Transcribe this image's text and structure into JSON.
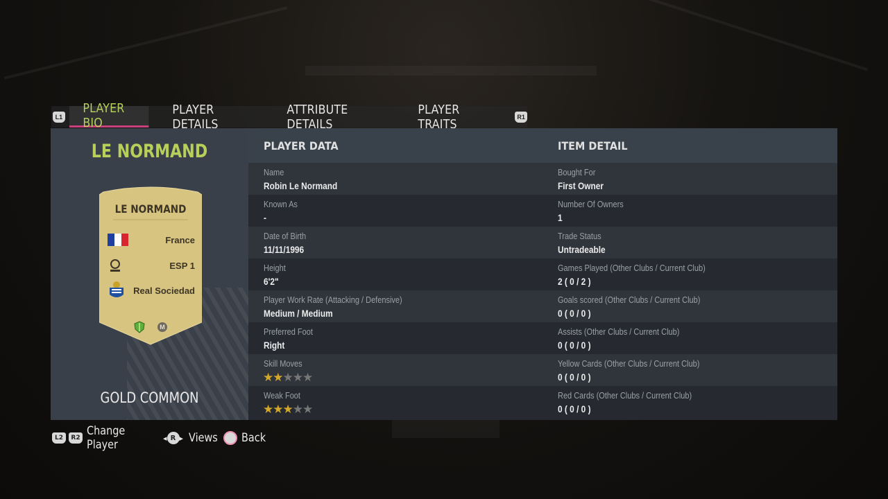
{
  "tabs": {
    "left_shoulder": "L1",
    "right_shoulder": "R1",
    "items": [
      {
        "label": "PLAYER BIO",
        "active": true
      },
      {
        "label": "PLAYER DETAILS",
        "active": false
      },
      {
        "label": "ATTRIBUTE DETAILS",
        "active": false
      },
      {
        "label": "PLAYER TRAITS",
        "active": false
      }
    ]
  },
  "player": {
    "title": "LE NORMAND",
    "card_name": "LE NORMAND",
    "nation": "France",
    "league": "ESP 1",
    "club": "Real Sociedad",
    "chemistry_badge": "M",
    "rarity": "GOLD COMMON"
  },
  "headers": {
    "player_data": "PLAYER DATA",
    "item_detail": "ITEM DETAIL"
  },
  "rows": [
    {
      "left_label": "Name",
      "left_value": "Robin Le Normand",
      "right_label": "Bought For",
      "right_value": "First Owner"
    },
    {
      "left_label": "Known As",
      "left_value": "-",
      "right_label": "Number Of Owners",
      "right_value": "1"
    },
    {
      "left_label": "Date of Birth",
      "left_value": "11/11/1996",
      "right_label": "Trade Status",
      "right_value": "Untradeable"
    },
    {
      "left_label": "Height",
      "left_value": "6'2\"",
      "right_label": "Games Played (Other Clubs / Current Club)",
      "right_value": "2 ( 0 / 2 )"
    },
    {
      "left_label": "Player Work Rate (Attacking / Defensive)",
      "left_value": "Medium / Medium",
      "right_label": "Goals scored (Other Clubs / Current Club)",
      "right_value": "0 ( 0 / 0 )"
    },
    {
      "left_label": "Preferred Foot",
      "left_value": "Right",
      "right_label": "Assists (Other Clubs / Current Club)",
      "right_value": "0 ( 0 / 0 )"
    },
    {
      "left_label": "Skill Moves",
      "left_stars": 2,
      "right_label": "Yellow Cards (Other Clubs / Current Club)",
      "right_value": "0 ( 0 / 0 )"
    },
    {
      "left_label": "Weak Foot",
      "left_stars": 3,
      "right_label": "Red Cards (Other Clubs / Current Club)",
      "right_value": "0 ( 0 / 0 )"
    }
  ],
  "footer": {
    "l2": "L2",
    "r2": "R2",
    "change_player": "Change Player",
    "r_stick": "R",
    "views": "Views",
    "back": "Back"
  },
  "colors": {
    "accent_green": "#b6d15b",
    "tab_underline": "#c8417a",
    "star_gold": "#d4a829",
    "card_gold": "#d6c480"
  }
}
